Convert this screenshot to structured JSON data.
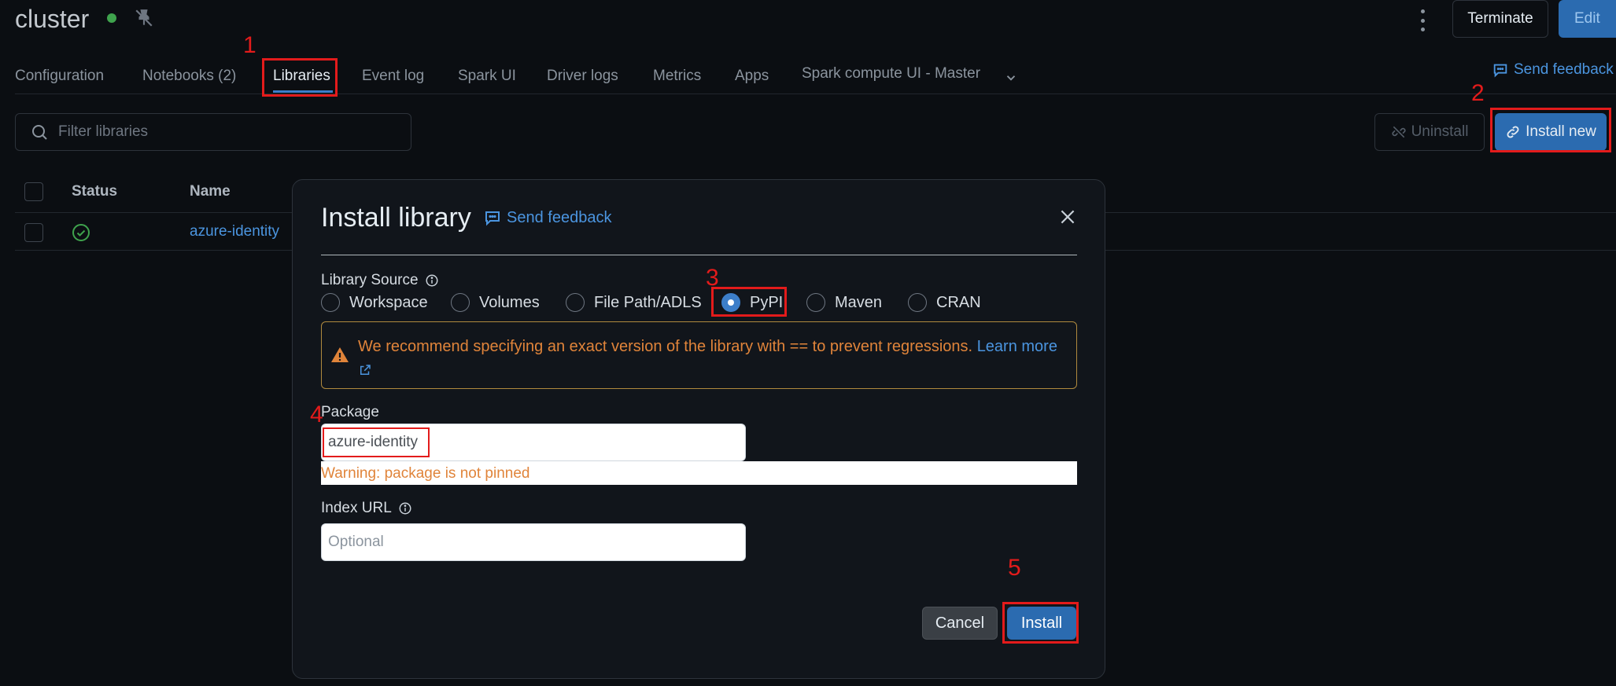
{
  "header": {
    "title": "cluster",
    "terminate_label": "Terminate",
    "edit_label": "Edit"
  },
  "tabs": [
    {
      "label": "Configuration"
    },
    {
      "label": "Notebooks (2)"
    },
    {
      "label": "Libraries"
    },
    {
      "label": "Event log"
    },
    {
      "label": "Spark UI"
    },
    {
      "label": "Driver logs"
    },
    {
      "label": "Metrics"
    },
    {
      "label": "Apps"
    },
    {
      "label": "Spark compute UI - Master"
    }
  ],
  "send_feedback_label": "Send feedback",
  "toolbar": {
    "filter_placeholder": "Filter libraries",
    "uninstall_label": "Uninstall",
    "install_new_label": "Install new"
  },
  "table": {
    "columns": [
      "Status",
      "Name"
    ],
    "rows": [
      {
        "name": "azure-identity",
        "status": "installed"
      }
    ]
  },
  "modal": {
    "title": "Install library",
    "feedback_label": "Send feedback",
    "source_label": "Library Source",
    "sources": [
      "Workspace",
      "Volumes",
      "File Path/ADLS",
      "PyPI",
      "Maven",
      "CRAN"
    ],
    "selected_source": "PyPI",
    "alert_text": "We recommend specifying an exact version of the library with == to prevent regressions.",
    "alert_link": "Learn more",
    "package_label": "Package",
    "package_value": "azure-identity",
    "package_warning": "Warning: package is not pinned",
    "index_url_label": "Index URL",
    "index_url_placeholder": "Optional",
    "cancel_label": "Cancel",
    "install_label": "Install"
  },
  "annotations": [
    "1",
    "2",
    "3",
    "4",
    "5"
  ],
  "colors": {
    "accent": "#2b6bb0",
    "link": "#4b95e0",
    "warning": "#e0843a",
    "annotation": "#e31b1b",
    "status_ok": "#3fa34d"
  }
}
